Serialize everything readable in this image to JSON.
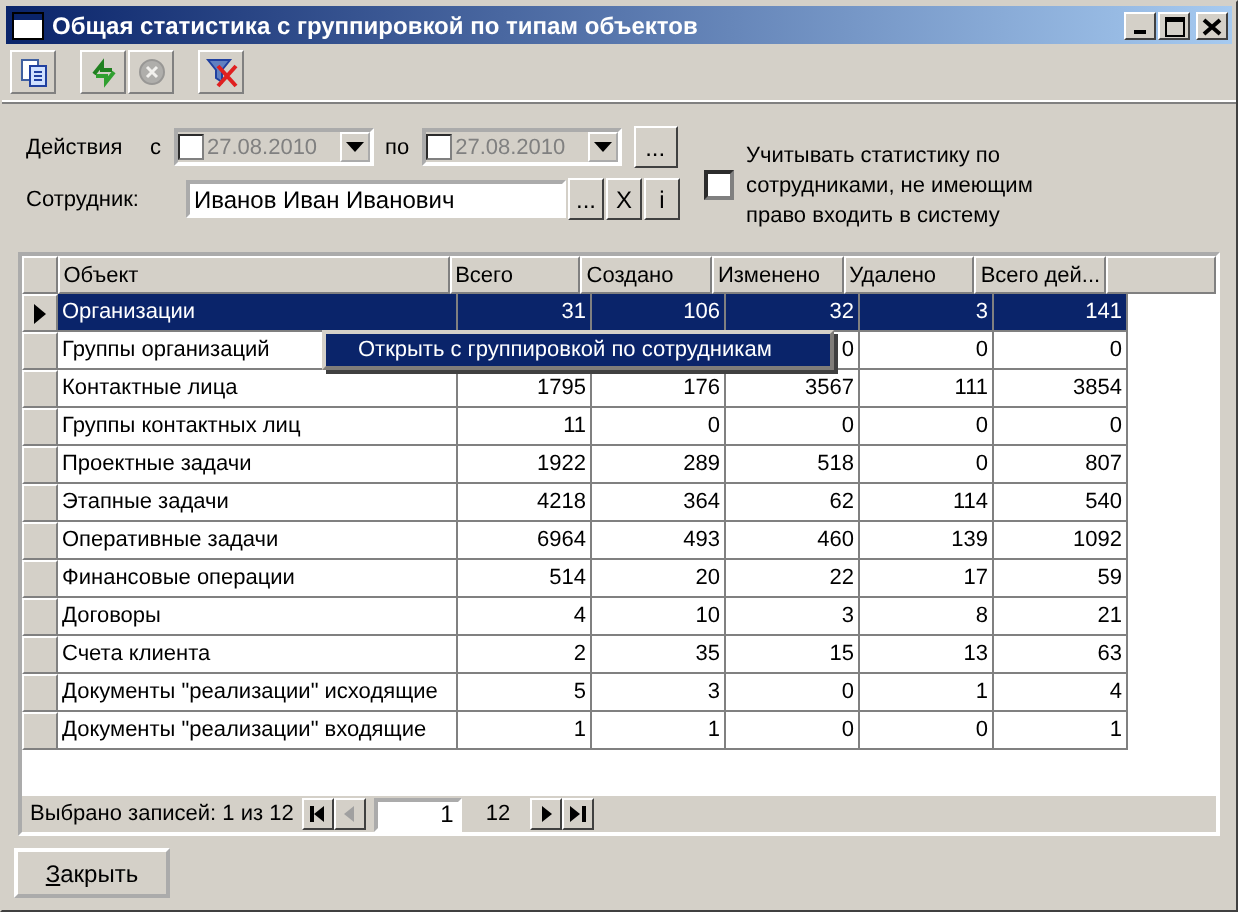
{
  "window": {
    "title": "Общая статистика с группировкой по типам объектов"
  },
  "toolbar": [
    {
      "kind": "copy",
      "disabled": false
    },
    {
      "kind": "refresh",
      "disabled": false
    },
    {
      "kind": "stop",
      "disabled": true
    },
    {
      "kind": "filter-clear",
      "disabled": false
    }
  ],
  "filter": {
    "label": "Действия",
    "from_label": "с",
    "from": {
      "value": "27.08.2010",
      "checked": false
    },
    "to_label": "по",
    "to": {
      "value": "27.08.2010",
      "checked": false
    },
    "range_button": "...",
    "employee_label": "Сотрудник:",
    "employee": "Иванов Иван Иванович",
    "employee_buttons": [
      "...",
      "X",
      "i"
    ],
    "include_option": {
      "label": "Учитывать статистику по сотрудниками, не имеющим право входить в систему",
      "checked": false
    }
  },
  "table": {
    "columns": [
      "Объект",
      "Всего",
      "Создано",
      "Изменено",
      "Удалено",
      "Всего дей..."
    ],
    "rows": [
      {
        "cells": [
          "Организации",
          "31",
          "106",
          "32",
          "3",
          "141"
        ],
        "selected": true
      },
      {
        "cells": [
          "Группы организаций",
          null,
          null,
          "0",
          "0",
          "0"
        ],
        "selected": false
      },
      {
        "cells": [
          "Контактные лица",
          "1795",
          "176",
          "3567",
          "111",
          "3854"
        ],
        "selected": false
      },
      {
        "cells": [
          "Группы контактных лиц",
          "11",
          "0",
          "0",
          "0",
          "0"
        ],
        "selected": false
      },
      {
        "cells": [
          "Проектные задачи",
          "1922",
          "289",
          "518",
          "0",
          "807"
        ],
        "selected": false
      },
      {
        "cells": [
          "Этапные задачи",
          "4218",
          "364",
          "62",
          "114",
          "540"
        ],
        "selected": false
      },
      {
        "cells": [
          "Оперативные задачи",
          "6964",
          "493",
          "460",
          "139",
          "1092"
        ],
        "selected": false
      },
      {
        "cells": [
          "Финансовые операции",
          "514",
          "20",
          "22",
          "17",
          "59"
        ],
        "selected": false
      },
      {
        "cells": [
          "Договоры",
          "4",
          "10",
          "3",
          "8",
          "21"
        ],
        "selected": false
      },
      {
        "cells": [
          "Счета клиента",
          "2",
          "35",
          "15",
          "13",
          "63"
        ],
        "selected": false
      },
      {
        "cells": [
          "Документы \"реализации\" исходящие",
          "5",
          "3",
          "0",
          "1",
          "4"
        ],
        "selected": false
      },
      {
        "cells": [
          "Документы \"реализации\" входящие",
          "1",
          "1",
          "0",
          "0",
          "1"
        ],
        "selected": false
      }
    ],
    "context_menu": {
      "items": [
        "Открыть с группировкой по сотрудникам"
      ]
    },
    "status": {
      "text": "Выбрано записей: 1 из 12",
      "page": "1",
      "total": "12",
      "nav": [
        {
          "kind": "first",
          "disabled": false
        },
        {
          "kind": "prev",
          "disabled": true
        },
        {
          "kind": "next",
          "disabled": false
        },
        {
          "kind": "last",
          "disabled": false
        }
      ]
    }
  },
  "close_button": "Закрыть"
}
